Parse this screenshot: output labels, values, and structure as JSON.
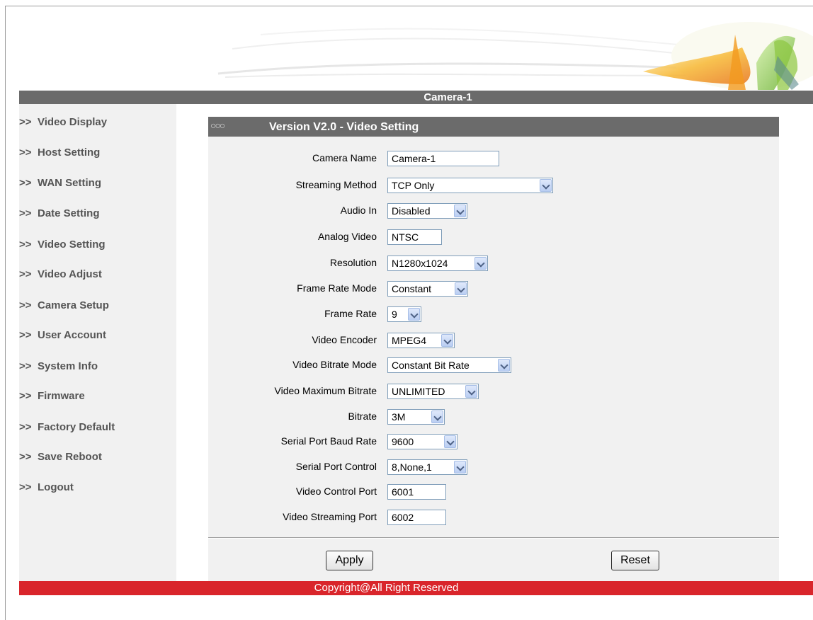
{
  "header": {
    "title": "Camera-1"
  },
  "sidebar": {
    "arrow": ">>",
    "items": [
      {
        "label": "Video Display"
      },
      {
        "label": "Host Setting"
      },
      {
        "label": "WAN Setting"
      },
      {
        "label": "Date Setting"
      },
      {
        "label": "Video Setting"
      },
      {
        "label": "Video Adjust"
      },
      {
        "label": "Camera Setup"
      },
      {
        "label": "User Account"
      },
      {
        "label": "System Info"
      },
      {
        "label": "Firmware"
      },
      {
        "label": "Factory Default"
      },
      {
        "label": "Save Reboot"
      },
      {
        "label": "Logout"
      }
    ]
  },
  "section": {
    "title": "Version V2.0 - Video Setting",
    "icon": "chain-icon"
  },
  "form": {
    "camera_name": {
      "label": "Camera Name",
      "value": "Camera-1"
    },
    "streaming_method": {
      "label": "Streaming Method",
      "value": "TCP Only"
    },
    "audio_in": {
      "label": "Audio In",
      "value": "Disabled"
    },
    "analog_video": {
      "label": "Analog Video",
      "value": "NTSC"
    },
    "resolution": {
      "label": "Resolution",
      "value": "N1280x1024"
    },
    "frame_rate_mode": {
      "label": "Frame Rate Mode",
      "value": "Constant"
    },
    "frame_rate": {
      "label": "Frame Rate",
      "value": "9"
    },
    "video_encoder": {
      "label": "Video Encoder",
      "value": "MPEG4"
    },
    "video_bitrate_mode": {
      "label": "Video Bitrate Mode",
      "value": "Constant Bit Rate"
    },
    "video_max_bitrate": {
      "label": "Video Maximum Bitrate",
      "value": "UNLIMITED"
    },
    "bitrate": {
      "label": "Bitrate",
      "value": "3M"
    },
    "serial_baud_rate": {
      "label": "Serial Port Baud Rate",
      "value": "9600"
    },
    "serial_port_control": {
      "label": "Serial Port Control",
      "value": "8,None,1"
    },
    "video_control_port": {
      "label": "Video Control Port",
      "value": "6001"
    },
    "video_streaming_port": {
      "label": "Video Streaming Port",
      "value": "6002"
    }
  },
  "buttons": {
    "apply": "Apply",
    "reset": "Reset"
  },
  "footer": {
    "text": "Copyright@All Right Reserved"
  },
  "colors": {
    "header_bar": "#6b6b6b",
    "footer_bar": "#d9252b",
    "panel_bg": "#f1f1f1"
  }
}
